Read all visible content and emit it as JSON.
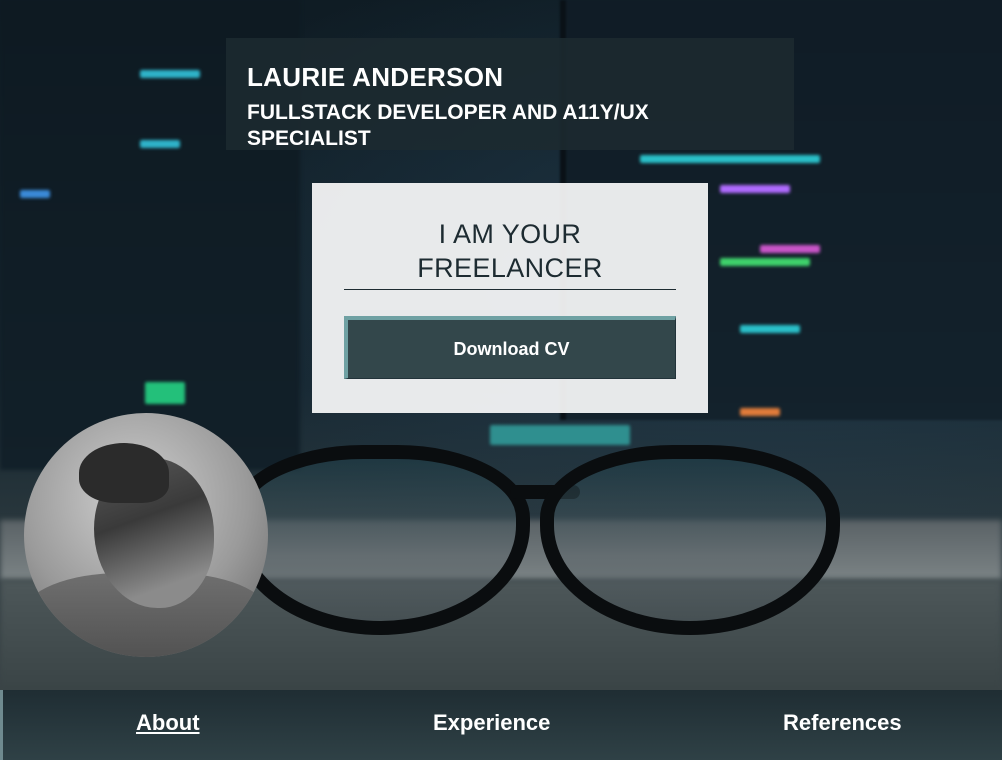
{
  "header": {
    "name": "LAURIE ANDERSON",
    "role": "FULLSTACK DEVELOPER AND A11Y/UX SPECIALIST"
  },
  "card": {
    "title": "I AM YOUR FREELANCER",
    "download_label": "Download CV"
  },
  "nav": {
    "items": [
      {
        "label": "About",
        "active": true
      },
      {
        "label": "Experience",
        "active": false
      },
      {
        "label": "References",
        "active": false
      }
    ]
  },
  "colors": {
    "header_bg": "#1c2a30",
    "button_bg": "#33474b",
    "button_accent": "#6fa1a3",
    "nav_bg": "#1f2d33",
    "text_dark": "#1d2b31"
  }
}
